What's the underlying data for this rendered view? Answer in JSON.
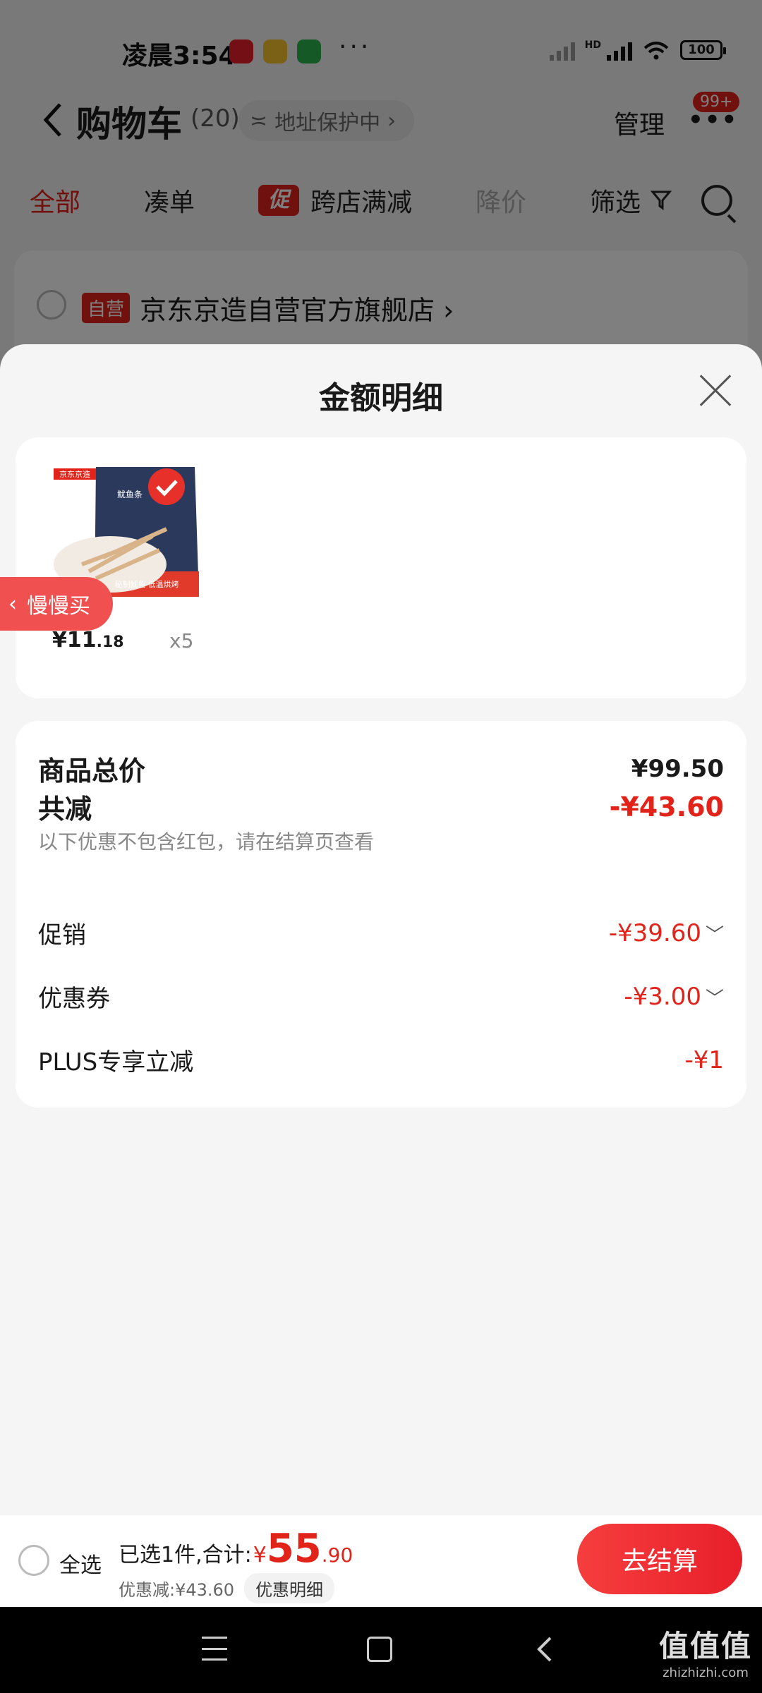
{
  "status_bar": {
    "time": "凌晨3:54",
    "more": "···",
    "network": "HD",
    "battery": "100",
    "apps": [
      "xiaohongshu-icon",
      "weibo-icon",
      "wechat-icon"
    ]
  },
  "cart_header": {
    "title": "购物车",
    "count": "(20)",
    "address_protect": "地址保护中",
    "manage": "管理",
    "badge": "99+"
  },
  "filter_tabs": {
    "all": "全部",
    "bundle": "凑单",
    "promo_badge": "促",
    "cross_store": "跨店满减",
    "price_drop": "降价",
    "filter": "筛选"
  },
  "store": {
    "badge": "自营",
    "name": "京东京造自营官方旗舰店"
  },
  "sheet": {
    "title": "金额明细"
  },
  "item": {
    "brand": "京东京造",
    "package_label": "鱿鱼条",
    "package_caption": "秘制鱿鱼 低温烘烤",
    "price_main": "¥11",
    "price_decimal": ".18",
    "quantity": "x5"
  },
  "slow_buy": {
    "label": "慢慢买"
  },
  "summary": {
    "total_label": "商品总价",
    "total_value": "¥99.50",
    "discount_label": "共减",
    "discount_value": "-¥43.60",
    "note": "以下优惠不包含红包，请在结算页查看",
    "promo_label": "促销",
    "promo_value": "-¥39.60",
    "coupon_label": "优惠券",
    "coupon_value": "-¥3.00",
    "plus_label": "PLUS专享立减",
    "plus_value": "-¥1"
  },
  "checkout": {
    "select_all": "全选",
    "selected_text": "已选1件,合计:",
    "yen": "¥",
    "amount_main": "55",
    "amount_decimal": ".90",
    "discount_text": "优惠减:¥43.60",
    "detail_button": "优惠明细",
    "checkout_button": "去结算"
  },
  "watermark": {
    "top": "值值值",
    "bottom": "zhizhizhi.com"
  },
  "colors": {
    "accent_red": "#e2231a",
    "sheet_bg": "#f5f5f5",
    "card_bg": "#ffffff"
  }
}
